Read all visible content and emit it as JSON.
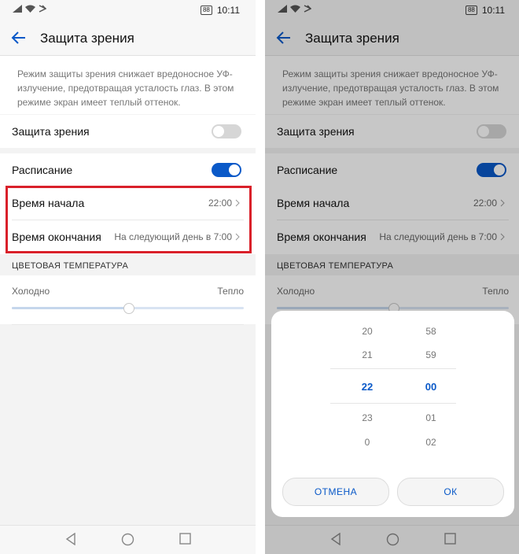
{
  "status": {
    "battery": "88",
    "time": "10:11"
  },
  "header": {
    "title": "Защита зрения"
  },
  "description": "Режим защиты зрения снижает вредоносное УФ-излучение, предотвращая усталость глаз. В этом режиме экран имеет теплый оттенок.",
  "eye_protection": {
    "label": "Защита зрения",
    "enabled": false
  },
  "schedule": {
    "label": "Расписание",
    "enabled": true
  },
  "start_time": {
    "label": "Время начала",
    "value": "22:00"
  },
  "end_time": {
    "label": "Время окончания",
    "value": "На следующий день в 7:00"
  },
  "color_temperature": {
    "title": "ЦВЕТОВАЯ ТЕМПЕРАТУРА",
    "cold_label": "Холодно",
    "warm_label": "Тепло",
    "level_fraction": 0.5
  },
  "picker": {
    "hours": [
      "20",
      "21",
      "22",
      "23",
      "0"
    ],
    "minutes": [
      "58",
      "59",
      "00",
      "01",
      "02"
    ],
    "selected_hour": "22",
    "selected_minute": "00",
    "cancel_label": "ОТМЕНА",
    "ok_label": "ОК"
  },
  "colors": {
    "accent": "#0a59c8",
    "highlight": "#d9202a"
  }
}
